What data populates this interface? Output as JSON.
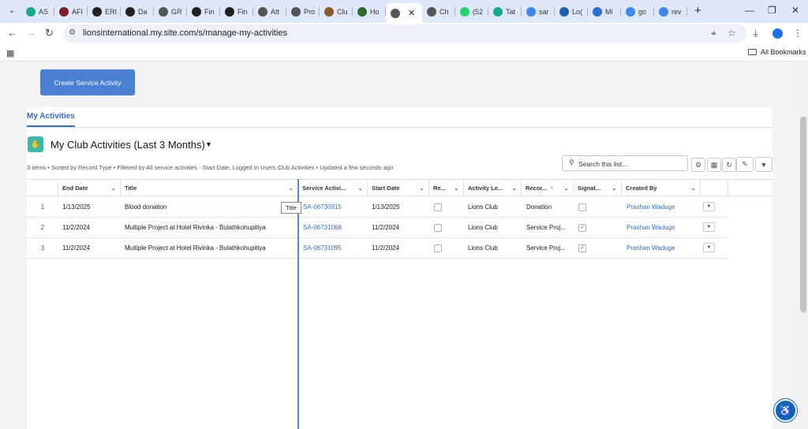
{
  "browser": {
    "tabs": [
      {
        "label": "AS",
        "fav": "#1aa88c"
      },
      {
        "label": "AFI",
        "fav": "#7a1f2b"
      },
      {
        "label": "ERI",
        "fav": "#222222"
      },
      {
        "label": "Da",
        "fav": "#222222"
      },
      {
        "label": "GR",
        "fav": "#555555"
      },
      {
        "label": "Fin",
        "fav": "#222222"
      },
      {
        "label": "Fin",
        "fav": "#222222"
      },
      {
        "label": "Att",
        "fav": "#555555"
      },
      {
        "label": "Pro",
        "fav": "#555555"
      },
      {
        "label": "Clu",
        "fav": "#8a5a2b"
      },
      {
        "label": "Ho",
        "fav": "#2f6b2f"
      },
      {
        "label": "",
        "fav": "#555555",
        "active": true
      },
      {
        "label": "Ch",
        "fav": "#555555"
      },
      {
        "label": "(52",
        "fav": "#25d366"
      },
      {
        "label": "Tat",
        "fav": "#1aa88c"
      },
      {
        "label": "sar",
        "fav": "#4285f4"
      },
      {
        "label": "Lo(",
        "fav": "#1c5fb0"
      },
      {
        "label": "Mi",
        "fav": "#2b6fd6"
      },
      {
        "label": "go",
        "fav": "#4285f4"
      },
      {
        "label": "rev",
        "fav": "#4285f4"
      }
    ],
    "url": "lionsinternational.my.site.com/s/manage-my-activities",
    "bookmarks_label": "All Bookmarks"
  },
  "page": {
    "create_button": "Create Service Activity",
    "tab_label": "My Activities",
    "list_title": "My Club Activities (Last 3 Months)",
    "list_info": "3 items • Sorted by Record Type • Filtered by All service activities - Start Date, Logged In Users Club Activities • Updated a few seconds ago",
    "search_placeholder": "Search this list...",
    "columns": [
      "End Date",
      "Title",
      "Service Activi...",
      "Start Date",
      "Re...",
      "Activity Le...",
      "Recor...",
      "Signat...",
      "Created By"
    ],
    "rows": [
      {
        "num": "1",
        "end": "1/13/2025",
        "title": "Blood donation",
        "sa": "SA-06730915",
        "start": "1/13/2025",
        "level": "Lions Club",
        "record": "Donation",
        "signed": false,
        "by": "Prashan Waduge"
      },
      {
        "num": "2",
        "end": "11/2/2024",
        "title": "Multiple Project at Hotel Rivinka - Bulathkohupitiya",
        "sa": "SA-06731068",
        "start": "11/2/2024",
        "level": "Lions Club",
        "record": "Service Proj...",
        "signed": true,
        "by": "Prashan Waduge"
      },
      {
        "num": "3",
        "end": "11/2/2024",
        "title": "Multiple Project at Hotel Rivinka - Bulathkohupitiya",
        "sa": "SA-06731095",
        "start": "11/2/2024",
        "level": "Lions Club",
        "record": "Service Proj...",
        "signed": true,
        "by": "Prashan Waduge"
      }
    ],
    "tooltip": "Title"
  },
  "colors": {
    "accent": "#3a6db5",
    "button": "#4a7fd1",
    "list_icon": "#3bb8a7"
  }
}
